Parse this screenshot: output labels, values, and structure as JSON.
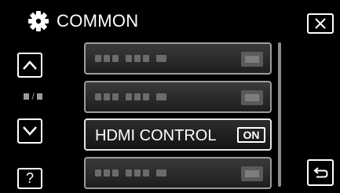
{
  "header": {
    "title": "COMMON",
    "icon": "gear-icon"
  },
  "sidebar": {
    "up_icon": "chevron-up-icon",
    "down_icon": "chevron-down-icon",
    "page_separator": "/",
    "help_label": "?"
  },
  "menu": {
    "items": [
      {
        "label": "",
        "value": "",
        "obscured": true
      },
      {
        "label": "",
        "value": "",
        "obscured": true
      },
      {
        "label": "HDMI CONTROL",
        "value": "ON",
        "obscured": false
      },
      {
        "label": "",
        "value": "",
        "obscured": true
      }
    ]
  },
  "controls": {
    "close_icon": "close-icon",
    "back_icon": "return-icon"
  },
  "colors": {
    "background": "#000000",
    "text": "#ffffff",
    "item_border": "#9c9c9c",
    "active_border": "#e6e6e6"
  }
}
